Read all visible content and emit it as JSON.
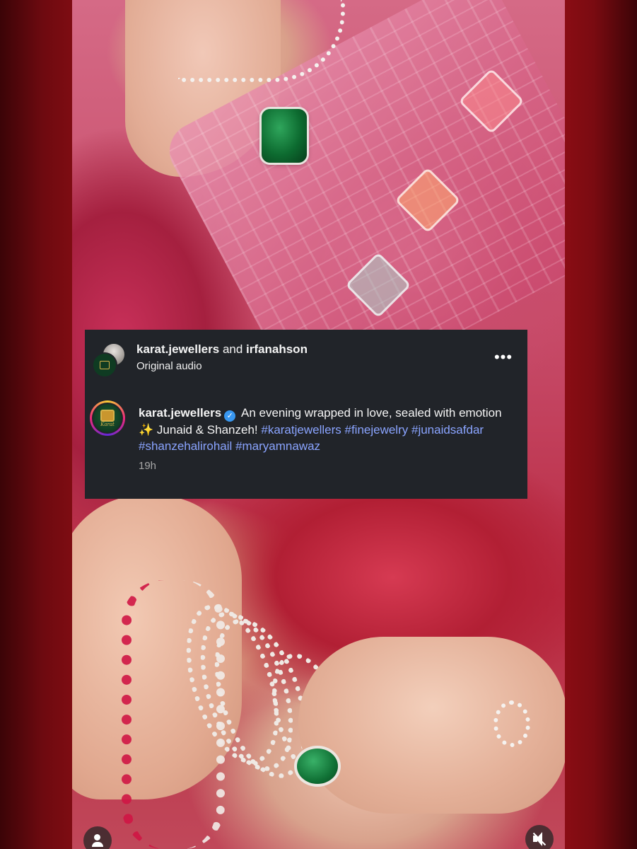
{
  "post_header": {
    "author_primary": "karat.jewellers",
    "joiner": "and",
    "author_secondary": "irfanahson",
    "audio_label": "Original audio",
    "more_label": "•••"
  },
  "caption": {
    "username": "karat.jewellers",
    "verified_glyph": "✓",
    "text_part1": "An evening wrapped in love, sealed with emotion",
    "sparkle": "✨",
    "text_part2": "Junaid & Shanzeh!",
    "hashtags": [
      "#karatjewellers",
      "#finejewelry",
      "#junaidsafdar",
      "#shanzehalirohail",
      "#maryamnawaz"
    ],
    "timestamp": "19h"
  },
  "brand_logo_text": "Karat",
  "icons": {
    "more": "more-horizontal-icon",
    "verified": "verified-badge-icon",
    "profile": "person-icon",
    "mute": "speaker-muted-icon"
  },
  "colors": {
    "card_bg": "#212429",
    "hashtag": "#8aa4ff",
    "verified": "#3897f0",
    "timestamp": "#a8a8a8",
    "backdrop": "#7a0b11"
  }
}
